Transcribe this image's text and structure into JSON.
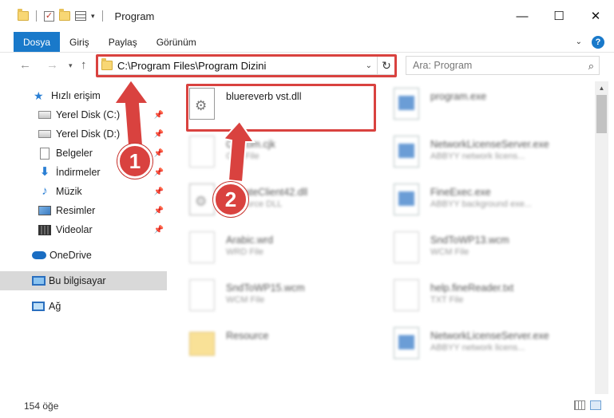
{
  "window": {
    "title": "Program",
    "controls": {
      "minimize": "—",
      "maximize": "☐",
      "close": "✕"
    }
  },
  "ribbon": {
    "tabs": [
      "Dosya",
      "Giriş",
      "Paylaş",
      "Görünüm"
    ],
    "help": "?"
  },
  "nav": {
    "address": "C:\\Program Files\\Program Dizini",
    "search_placeholder": "Ara: Program"
  },
  "sidebar": {
    "items": [
      {
        "label": "Hızlı erişim",
        "icon": "star-icon"
      },
      {
        "label": "Yerel Disk (C:)",
        "icon": "drive-icon",
        "pinned": true
      },
      {
        "label": "Yerel Disk (D:)",
        "icon": "drive-icon",
        "pinned": true
      },
      {
        "label": "Belgeler",
        "icon": "documents-icon",
        "pinned": true
      },
      {
        "label": "İndirmeler",
        "icon": "download-icon",
        "pinned": true
      },
      {
        "label": "Müzik",
        "icon": "music-icon",
        "pinned": true
      },
      {
        "label": "Resimler",
        "icon": "pictures-icon",
        "pinned": true
      },
      {
        "label": "Videolar",
        "icon": "videos-icon",
        "pinned": true
      },
      {
        "label": "OneDrive",
        "icon": "onedrive-icon"
      },
      {
        "label": "Bu bilgisayar",
        "icon": "this-pc-icon",
        "selected": true
      },
      {
        "label": "Ağ",
        "icon": "network-icon"
      }
    ]
  },
  "files": [
    {
      "name": "bluereverb vst.dll",
      "sub": "",
      "kind": "dll",
      "highlighted": true
    },
    {
      "name": "program.exe",
      "sub": "",
      "kind": "exe"
    },
    {
      "name": "Custom.cjk",
      "sub": "CJK File",
      "kind": "doc"
    },
    {
      "name": "NetworkLicenseServer.exe",
      "sub": "ABBYY network licens...",
      "kind": "exe"
    },
    {
      "name": "UpdateClient42.dll",
      "sub": "Resource DLL",
      "kind": "dll"
    },
    {
      "name": "FineExec.exe",
      "sub": "ABBYY background exe...",
      "kind": "exe"
    },
    {
      "name": "Arabic.wrd",
      "sub": "WRD File",
      "kind": "doc"
    },
    {
      "name": "SndToWP13.wcm",
      "sub": "WCM File",
      "kind": "doc"
    },
    {
      "name": "SndToWP15.wcm",
      "sub": "WCM File",
      "kind": "doc"
    },
    {
      "name": "help.fineReader.txt",
      "sub": "TXT File",
      "kind": "txt"
    },
    {
      "name": "Resource",
      "sub": "",
      "kind": "folder"
    },
    {
      "name": "NetworkLicenseServer.exe",
      "sub": "ABBYY network licens...",
      "kind": "exe"
    }
  ],
  "callouts": [
    "1",
    "2"
  ],
  "status": {
    "count": "154 öğe"
  },
  "colors": {
    "accent": "#1979ca",
    "callout": "#d9423f"
  }
}
